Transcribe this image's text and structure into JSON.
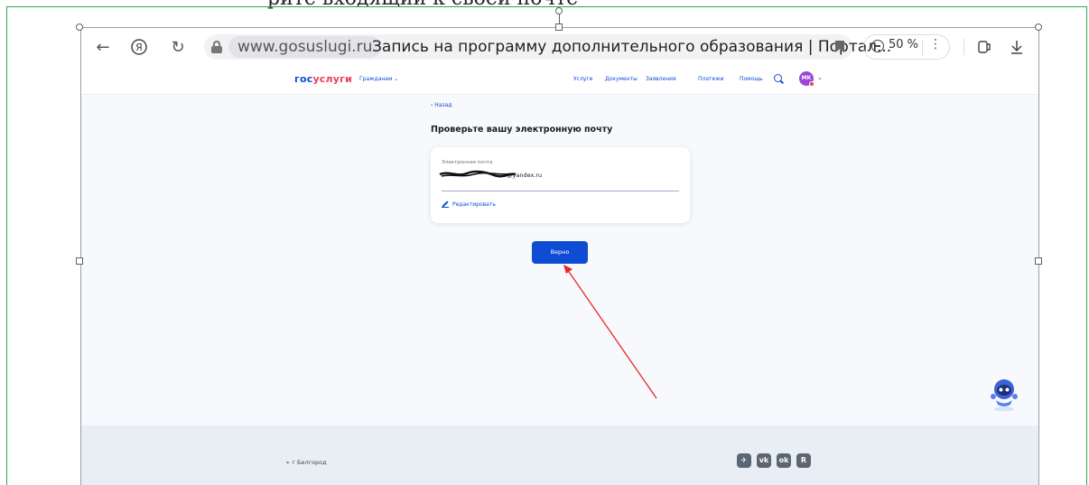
{
  "document": {
    "partial_text": "рите входящий к своей почте"
  },
  "browser": {
    "domain": "www.gosuslugi.ru",
    "page_title": "Запись на программу дополнительного образования | Портал...",
    "zoom": "50 %"
  },
  "site": {
    "logo_part1": "гос",
    "logo_part2": "услуги",
    "citizens_menu": "Гражданам ⌄",
    "nav": [
      "Услуги",
      "Документы",
      "Заявления",
      "Платежи",
      "Помощь"
    ],
    "avatar_initials": "МК"
  },
  "page": {
    "back_label": "‹ Назад",
    "heading": "Проверьте вашу электронную почту",
    "email_label": "Электронная почта",
    "email_value_visible_suffix": "@yandex.ru",
    "edit_label": "Редактировать",
    "confirm_label": "Верно"
  },
  "footer": {
    "city": "г Белгород",
    "socials": [
      "telegram",
      "vk",
      "odnoklassniki",
      "rutube"
    ]
  },
  "colors": {
    "brand_blue": "#0d4cd3",
    "brand_red": "#ee3f58",
    "annotation_arrow": "#e8272a",
    "frame_green": "#2ea44f"
  }
}
